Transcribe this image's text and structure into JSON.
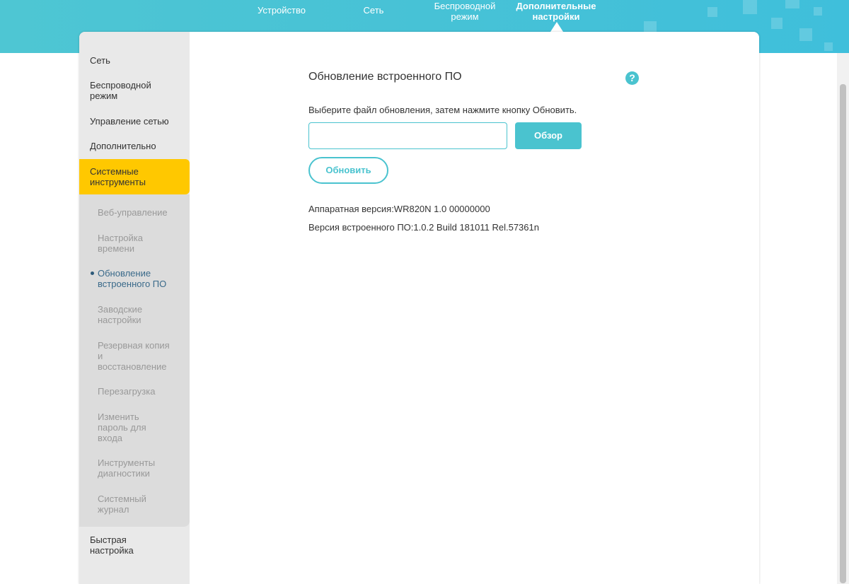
{
  "topnav": {
    "items": [
      {
        "label": "Устройство"
      },
      {
        "label": "Сеть"
      },
      {
        "label_line1": "Беспроводной",
        "label_line2": "режим"
      },
      {
        "label_line1": "Дополнительные",
        "label_line2": "настройки"
      }
    ]
  },
  "sidebar": {
    "items": [
      {
        "label": "Сеть"
      },
      {
        "label_line1": "Беспроводной",
        "label_line2": "режим"
      },
      {
        "label": "Управление сетью"
      },
      {
        "label": "Дополнительно"
      },
      {
        "label_line1": "Системные",
        "label_line2": "инструменты"
      },
      {
        "label_line1": "Быстрая",
        "label_line2": "настройка"
      }
    ],
    "submenu": [
      {
        "lines": [
          "Веб-управление"
        ]
      },
      {
        "lines": [
          "Настройка",
          "времени"
        ]
      },
      {
        "lines": [
          "Обновление",
          "встроенного ПО"
        ]
      },
      {
        "lines": [
          "Заводские",
          "настройки"
        ]
      },
      {
        "lines": [
          "Резервная копия",
          "и",
          "восстановление"
        ]
      },
      {
        "lines": [
          "Перезагрузка"
        ]
      },
      {
        "lines": [
          "Изменить",
          "пароль для",
          "входа"
        ]
      },
      {
        "lines": [
          "Инструменты",
          "диагностики"
        ]
      },
      {
        "lines": [
          "Системный",
          "журнал"
        ]
      }
    ]
  },
  "content": {
    "title": "Обновление встроенного ПО",
    "help_icon": "help-icon",
    "help_glyph": "?",
    "instruction": "Выберите файл обновления, затем нажмите кнопку Обновить.",
    "file_input_value": "",
    "browse_label": "Обзор",
    "update_label": "Обновить",
    "hardware_version": "Аппаратная версия:WR820N 1.0 00000000",
    "firmware_version": "Версия встроенного ПО:1.0.2 Build 181011 Rel.57361n"
  },
  "colors": {
    "accent": "#4ac3cf",
    "active_menu": "#ffc800",
    "banner": "#47c2d6"
  }
}
